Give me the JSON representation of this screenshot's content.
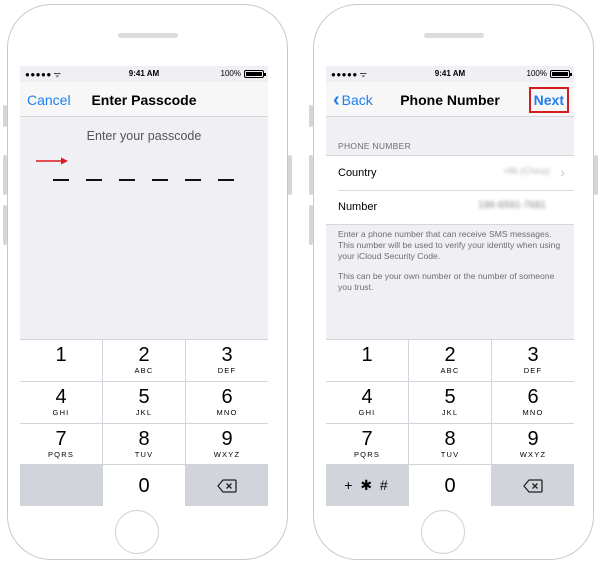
{
  "status": {
    "signal": "●●●●●",
    "time": "9:41 AM",
    "battery": "100%"
  },
  "left_screen": {
    "nav": {
      "cancel_label": "Cancel",
      "title": "Enter Passcode"
    },
    "prompt": "Enter your passcode",
    "passcode_length": 6
  },
  "right_screen": {
    "nav": {
      "back_label": "Back",
      "title": "Phone Number",
      "next_label": "Next"
    },
    "section_header": "PHONE NUMBER",
    "country": {
      "label": "Country",
      "value": "+86 (China)"
    },
    "number": {
      "label": "Number",
      "value": "186-6591-7681"
    },
    "help_text_1": "Enter a phone number that can receive SMS messages. This number will be used to verify your identity when using your iCloud Security Code.",
    "help_text_2": "This can be your own number or the number of someone you trust."
  },
  "keypad": {
    "keys": [
      {
        "digit": "1",
        "letters": ""
      },
      {
        "digit": "2",
        "letters": "ABC"
      },
      {
        "digit": "3",
        "letters": "DEF"
      },
      {
        "digit": "4",
        "letters": "GHI"
      },
      {
        "digit": "5",
        "letters": "JKL"
      },
      {
        "digit": "6",
        "letters": "MNO"
      },
      {
        "digit": "7",
        "letters": "PQRS"
      },
      {
        "digit": "8",
        "letters": "TUV"
      },
      {
        "digit": "9",
        "letters": "WXYZ"
      }
    ],
    "zero": "0",
    "symbols": "+ ✱ #"
  },
  "colors": {
    "accent": "#1f7ff2",
    "highlight": "#d71920",
    "background": "#efeff4"
  },
  "icons": [
    "wifi-icon",
    "battery-icon",
    "chevron-left-icon",
    "chevron-right-icon",
    "delete-icon",
    "red-arrow-icon"
  ]
}
